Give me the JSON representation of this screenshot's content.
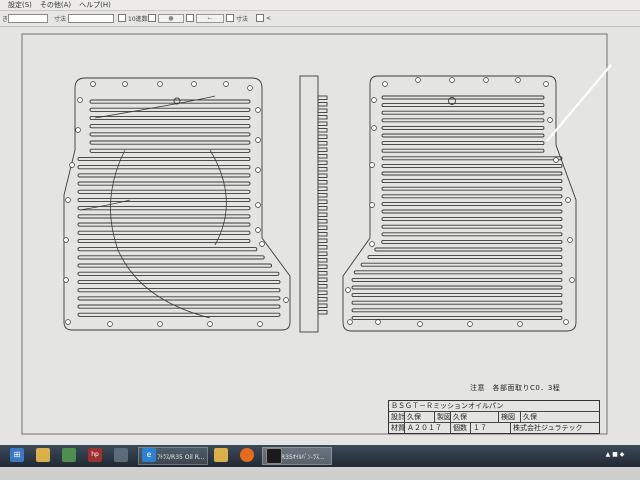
{
  "menu": {
    "items": [
      "設定(S)",
      "その他(A)",
      "ヘルプ(H)"
    ]
  },
  "toolbar": {
    "prefix_label": "き",
    "scale_label": "寸法",
    "checkbox1_label": "10進数",
    "checkbox2_label": "寸法",
    "checkbox3_label": "<"
  },
  "drawing": {
    "note": "注意　各部面取りC0．3程",
    "title_block": {
      "product": "ＢＳＧＴ－Ｒミッションオイルパン",
      "design_label": "設計",
      "design_name": "久保",
      "drawing_label": "製図",
      "drawing_name": "久保",
      "check_label": "検図",
      "check_name": "久保",
      "material_label": "材質",
      "material_value": "Ａ２０１７",
      "quantity_label": "個数",
      "quantity_value": "１７",
      "company": "株式会社ジュラテック"
    }
  },
  "taskbar": {
    "apps": [
      "start-icon",
      "folder-icon",
      "app-icon",
      "hp-icon",
      "app-icon",
      "ie-icon",
      "explorer-icon",
      "firefox-icon",
      "cad-icon"
    ],
    "hp_label": "hp",
    "window1_label": "ﾌﾄﾗｽ/R35 Oil R...",
    "window2_label": "R35ｵｲﾙﾊﾟﾝ-ﾗｽ..."
  },
  "colors": {
    "line": "#3a3a3a",
    "paper": "#e4e5e2",
    "taskbar": "#27313c"
  }
}
